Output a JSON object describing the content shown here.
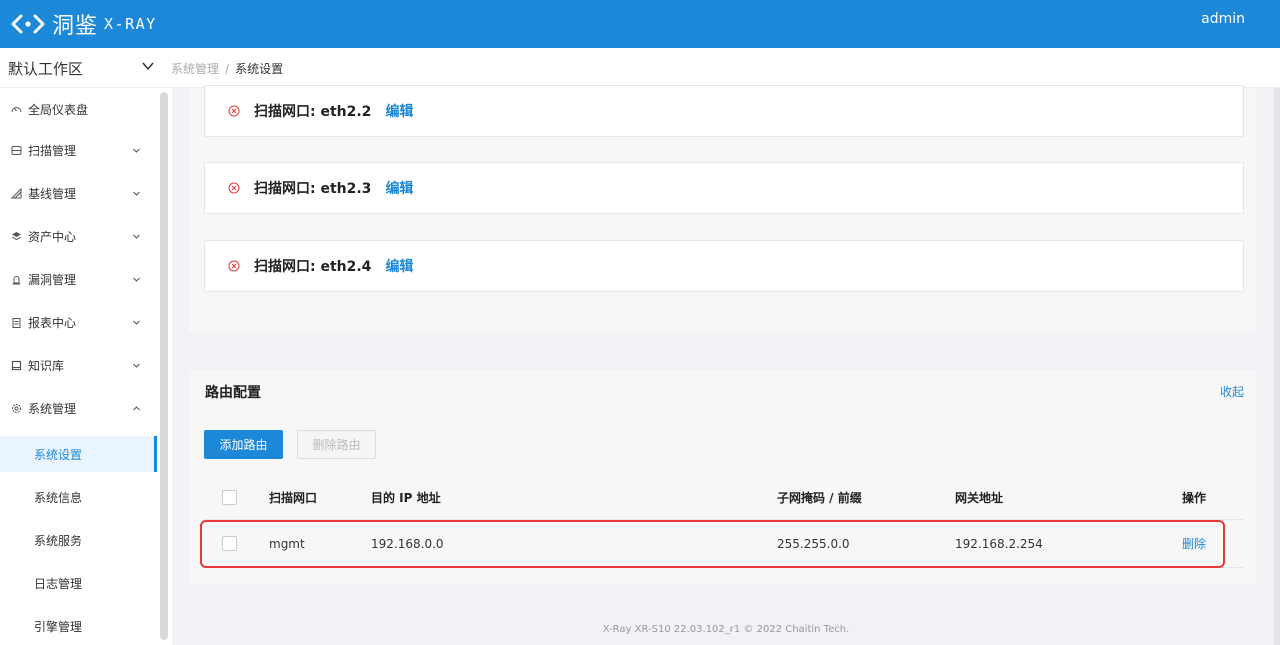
{
  "header": {
    "logo_cn": "洞鉴",
    "logo_en": "X-RAY",
    "user": "admin"
  },
  "subbar": {
    "workspace": "默认工作区",
    "breadcrumb": [
      "系统管理",
      "系统设置"
    ],
    "breadcrumb_sep": "/"
  },
  "sidebar": {
    "items": [
      {
        "label": "全局仪表盘",
        "icon": "dashboard-icon",
        "active": false
      },
      {
        "label": "扫描管理",
        "icon": "scan-icon",
        "chevron": "down"
      },
      {
        "label": "基线管理",
        "icon": "baseline-icon",
        "chevron": "down"
      },
      {
        "label": "资产中心",
        "icon": "asset-icon",
        "chevron": "down"
      },
      {
        "label": "漏洞管理",
        "icon": "vuln-icon",
        "chevron": "down"
      },
      {
        "label": "报表中心",
        "icon": "report-icon",
        "chevron": "down"
      },
      {
        "label": "知识库",
        "icon": "book-icon",
        "chevron": "down"
      },
      {
        "label": "系统管理",
        "icon": "gear-icon",
        "chevron": "up"
      }
    ],
    "sub_items": [
      {
        "label": "系统设置",
        "active": true
      },
      {
        "label": "系统信息",
        "active": false
      },
      {
        "label": "系统服务",
        "active": false
      },
      {
        "label": "日志管理",
        "active": false
      },
      {
        "label": "引擎管理",
        "active": false
      }
    ]
  },
  "interfaces": [
    {
      "title": "扫描网口: eth2.2",
      "edit": "编辑"
    },
    {
      "title": "扫描网口: eth2.3",
      "edit": "编辑"
    },
    {
      "title": "扫描网口: eth2.4",
      "edit": "编辑"
    }
  ],
  "route": {
    "title": "路由配置",
    "collapse": "收起",
    "add_button": "添加路由",
    "delete_button": "删除路由",
    "columns": [
      "扫描网口",
      "目的 IP 地址",
      "子网掩码 / 前缀",
      "网关地址",
      "操作"
    ],
    "rows": [
      {
        "iface": "mgmt",
        "dest_ip": "192.168.0.0",
        "mask": "255.255.0.0",
        "gateway": "192.168.2.254",
        "action": "删除"
      }
    ]
  },
  "footer": "X-Ray XR-S10 22.03.102_r1 © 2022 Chaitin Tech.",
  "colors": {
    "brand": "#1e88d8",
    "highlight": "#e53935",
    "error": "#e53935"
  }
}
